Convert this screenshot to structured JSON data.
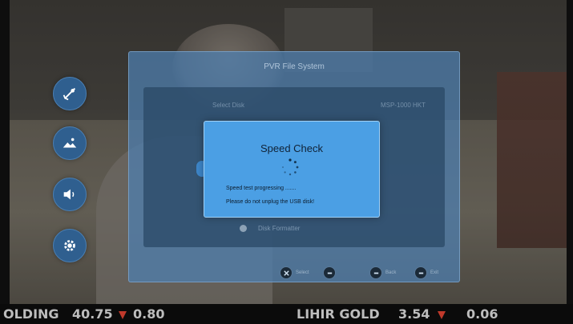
{
  "panel": {
    "title": "PVR File System",
    "select_disk_label": "Select Disk",
    "select_disk_value": "MSP-1000 HKT",
    "format_label": "Disk Formatter"
  },
  "dialog": {
    "title": "Speed Check",
    "line1": "Speed test progressing .......",
    "line2": "Please do not unplug the USB disk!"
  },
  "hints": [
    {
      "label": "Select",
      "icon": "cross-button-icon"
    },
    {
      "label": "",
      "icon": "circle-button-icon"
    },
    {
      "label": "Back",
      "icon": "return-button-icon"
    },
    {
      "label": "Exit",
      "icon": "exit-button-icon"
    }
  ],
  "ticker": {
    "item1_name": "OLDING",
    "item1_price": "40.75",
    "item1_change": "0.80",
    "item2_name": "LIHIR GOLD",
    "item2_price": "3.54",
    "item2_change": "0.06",
    "down_color": "#c0392b"
  },
  "side_icons": [
    "satellite-dish-icon",
    "picture-icon",
    "speaker-icon",
    "gear-icon"
  ],
  "colors": {
    "dialog_bg": "#4b9fe4",
    "panel_bg": "#4e80b2",
    "icon_bg": "#2f5f8f"
  }
}
